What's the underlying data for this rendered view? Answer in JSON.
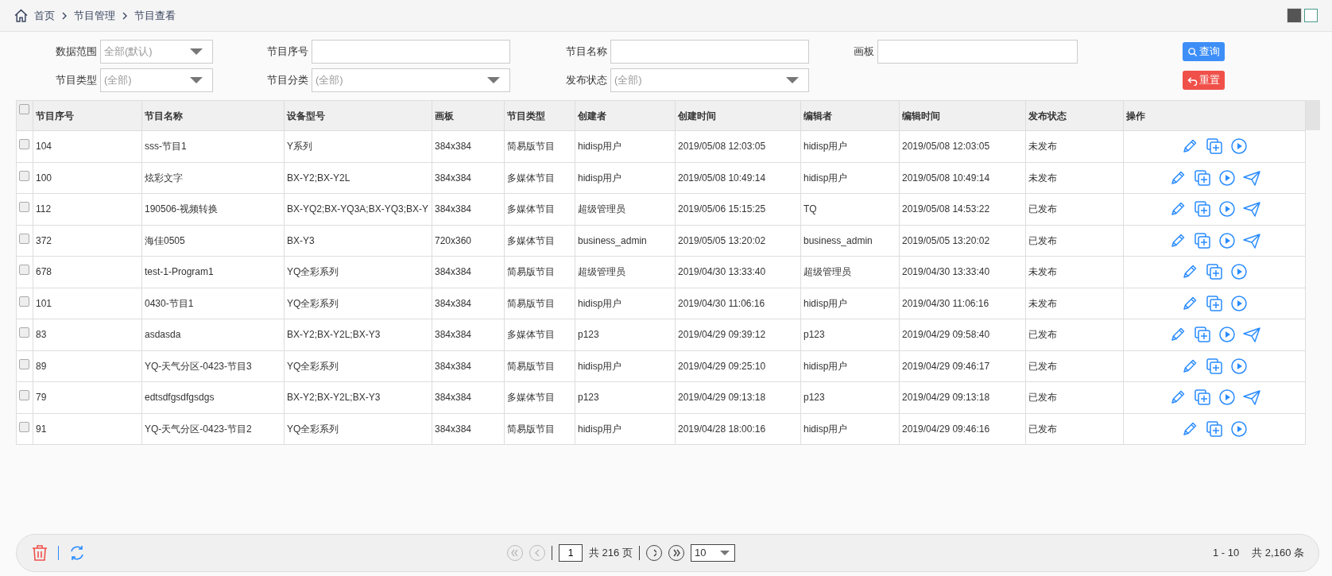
{
  "breadcrumb": [
    "首页",
    "节目管理",
    "节目查看"
  ],
  "view_toggles": [
    {
      "kind": "filled",
      "selected": true
    },
    {
      "kind": "outlined",
      "selected": false
    }
  ],
  "filters": [
    [
      {
        "label": "数据范围",
        "kind": "select",
        "value": "全部(默认)"
      },
      {
        "label": "节目序号",
        "kind": "input"
      },
      {
        "label": "节目名称",
        "kind": "input"
      },
      {
        "label": "画板",
        "kind": "input"
      }
    ],
    [
      {
        "label": "节目类型",
        "kind": "select",
        "value": "(全部)"
      },
      {
        "label": "节目分类",
        "kind": "select",
        "value": "(全部)"
      },
      {
        "label": "发布状态",
        "kind": "select",
        "value": "(全部)"
      }
    ]
  ],
  "buttons": [
    {
      "kind": "search",
      "label": "查询"
    },
    {
      "kind": "reset",
      "label": "重置"
    }
  ],
  "table": {
    "select_all": {
      "checked": false
    },
    "columns": [
      "节目序号",
      "节目名称",
      "设备型号",
      "画板",
      "节目类型",
      "创建者",
      "创建时间",
      "编辑者",
      "编辑时间",
      "发布状态",
      "操作"
    ],
    "rows": [
      {
        "selected": false,
        "cells": [
          "104",
          "sss-节目1",
          "Y系列",
          "384x384",
          "简易版节目",
          "hidisp用户",
          "2019/05/08 12:03:05",
          "hidisp用户",
          "2019/05/08 12:03:05",
          "未发布"
        ],
        "can_send": false
      },
      {
        "selected": false,
        "cells": [
          "100",
          "炫彩文字",
          "BX-Y2;BX-Y2L",
          "384x384",
          "多媒体节目",
          "hidisp用户",
          "2019/05/08 10:49:14",
          "hidisp用户",
          "2019/05/08 10:49:14",
          "未发布"
        ],
        "can_send": true
      },
      {
        "selected": false,
        "cells": [
          "112",
          "190506-视频转换",
          "BX-YQ2;BX-YQ3A;BX-YQ3;BX-Y",
          "384x384",
          "多媒体节目",
          "超级管理员",
          "2019/05/06 15:15:25",
          "TQ",
          "2019/05/08 14:53:22",
          "已发布"
        ],
        "can_send": true
      },
      {
        "selected": false,
        "cells": [
          "372",
          "海佳0505",
          "BX-Y3",
          "720x360",
          "多媒体节目",
          "business_admin",
          "2019/05/05 13:20:02",
          "business_admin",
          "2019/05/05 13:20:02",
          "已发布"
        ],
        "can_send": true
      },
      {
        "selected": false,
        "cells": [
          "678",
          "test-1-Program1",
          "YQ全彩系列",
          "384x384",
          "简易版节目",
          "超级管理员",
          "2019/04/30 13:33:40",
          "超级管理员",
          "2019/04/30 13:33:40",
          "未发布"
        ],
        "can_send": false
      },
      {
        "selected": false,
        "cells": [
          "101",
          "0430-节目1",
          "YQ全彩系列",
          "384x384",
          "简易版节目",
          "hidisp用户",
          "2019/04/30 11:06:16",
          "hidisp用户",
          "2019/04/30 11:06:16",
          "未发布"
        ],
        "can_send": false
      },
      {
        "selected": false,
        "cells": [
          "83",
          "asdasda",
          "BX-Y2;BX-Y2L;BX-Y3",
          "384x384",
          "多媒体节目",
          "p123",
          "2019/04/29 09:39:12",
          "p123",
          "2019/04/29 09:58:40",
          "已发布"
        ],
        "can_send": true
      },
      {
        "selected": false,
        "cells": [
          "89",
          "YQ-天气分区-0423-节目3",
          "YQ全彩系列",
          "384x384",
          "简易版节目",
          "hidisp用户",
          "2019/04/29 09:25:10",
          "hidisp用户",
          "2019/04/29 09:46:17",
          "已发布"
        ],
        "can_send": false
      },
      {
        "selected": false,
        "cells": [
          "79",
          "edtsdfgsdfgsdgs",
          "BX-Y2;BX-Y2L;BX-Y3",
          "384x384",
          "多媒体节目",
          "p123",
          "2019/04/29 09:13:18",
          "p123",
          "2019/04/29 09:13:18",
          "已发布"
        ],
        "can_send": true
      },
      {
        "selected": false,
        "cells": [
          "91",
          "YQ-天气分区-0423-节目2",
          "YQ全彩系列",
          "384x384",
          "简易版节目",
          "hidisp用户",
          "2019/04/28 18:00:16",
          "hidisp用户",
          "2019/04/29 09:46:16",
          "已发布"
        ],
        "can_send": false
      }
    ]
  },
  "footer": {
    "tools": [
      {
        "kind": "delete"
      },
      {
        "kind": "refresh"
      }
    ],
    "pager": {
      "nav": [
        {
          "kind": "first",
          "disabled": true
        },
        {
          "kind": "prev",
          "disabled": true
        },
        {
          "kind": "next",
          "disabled": false
        },
        {
          "kind": "last",
          "disabled": false
        }
      ],
      "page": "1",
      "total_pages": "共 216 页",
      "page_size": "10"
    },
    "range": "1 - 10",
    "total": "共 2,160 条"
  }
}
